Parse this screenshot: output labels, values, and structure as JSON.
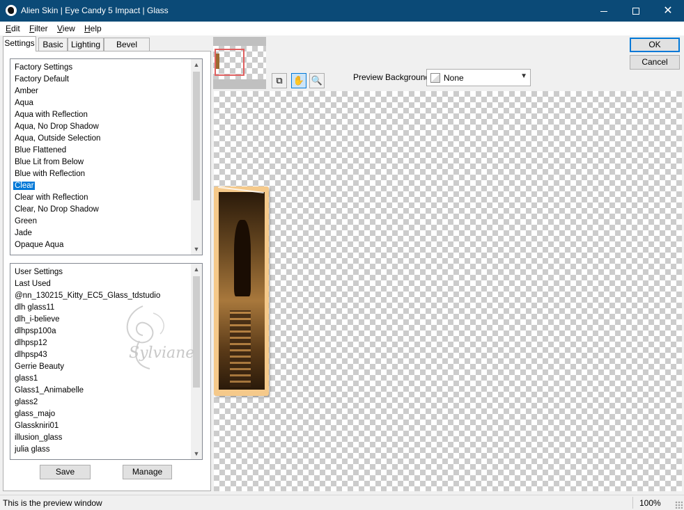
{
  "window": {
    "title": "Alien Skin | Eye Candy 5 Impact | Glass",
    "icon": "eye-candy-app-icon"
  },
  "menu": {
    "items": [
      {
        "label": "Edit",
        "accel": "E",
        "rest": "dit"
      },
      {
        "label": "Filter",
        "accel": "F",
        "rest": "ilter"
      },
      {
        "label": "View",
        "accel": "V",
        "rest": "iew"
      },
      {
        "label": "Help",
        "accel": "H",
        "rest": "elp"
      }
    ]
  },
  "tabs": [
    "Settings",
    "Basic",
    "Lighting",
    "Bevel Profile"
  ],
  "active_tab": "Settings",
  "factory_settings": {
    "header": "Factory Settings",
    "items": [
      "Factory Default",
      "Amber",
      "Aqua",
      "Aqua with Reflection",
      "Aqua, No Drop Shadow",
      "Aqua, Outside Selection",
      "Blue Flattened",
      "Blue Lit from Below",
      "Blue with Reflection",
      "Clear",
      "Clear with Reflection",
      "Clear, No Drop Shadow",
      "Green",
      "Jade",
      "Opaque Aqua"
    ],
    "selected": "Clear"
  },
  "user_settings": {
    "header": "User Settings",
    "items": [
      "Last Used",
      "@nn_130215_Kitty_EC5_Glass_tdstudio",
      "dlh glass11",
      "dlh_i-believe",
      "dlhpsp100a",
      "dlhpsp12",
      "dlhpsp43",
      "Gerrie Beauty",
      "glass1",
      "Glass1_Animabelle",
      "glass2",
      "glass_majo",
      "Glasskniri01",
      "illusion_glass",
      "julia glass"
    ]
  },
  "buttons": {
    "save": "Save",
    "manage": "Manage",
    "ok": "OK",
    "cancel": "Cancel"
  },
  "preview": {
    "background_label": "Preview Background:",
    "background_value": "None",
    "tools": [
      "navigator-compare-icon",
      "hand-pan-icon",
      "zoom-magnifier-icon"
    ],
    "watermark": "Sylviane"
  },
  "status": {
    "text": "This is the preview window",
    "zoom": "100%"
  },
  "colors": {
    "titlebar": "#0b4a77",
    "selection": "#0078d7",
    "frame": "#f5c98a"
  }
}
